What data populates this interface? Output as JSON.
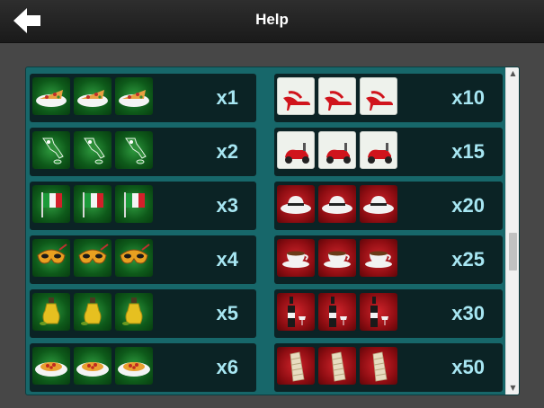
{
  "header": {
    "title": "Help"
  },
  "paytable": {
    "left": [
      {
        "symbol": "pizza-icon",
        "multiplier": "x1"
      },
      {
        "symbol": "italy-map-icon",
        "multiplier": "x2"
      },
      {
        "symbol": "italian-flag-icon",
        "multiplier": "x3"
      },
      {
        "symbol": "carnival-mask-icon",
        "multiplier": "x4"
      },
      {
        "symbol": "olive-oil-icon",
        "multiplier": "x5"
      },
      {
        "symbol": "spaghetti-icon",
        "multiplier": "x6"
      }
    ],
    "right": [
      {
        "symbol": "red-heels-icon",
        "multiplier": "x10"
      },
      {
        "symbol": "scooter-icon",
        "multiplier": "x15"
      },
      {
        "symbol": "hat-icon",
        "multiplier": "x20"
      },
      {
        "symbol": "coffee-cup-icon",
        "multiplier": "x25"
      },
      {
        "symbol": "wine-bottle-icon",
        "multiplier": "x30"
      },
      {
        "symbol": "leaning-tower-icon",
        "multiplier": "x50"
      }
    ]
  },
  "colors": {
    "green_tile": "#1f7a2e",
    "white_tile": "#eef2ec",
    "red_tile": "#b3141b",
    "multiplier_text": "#a7e6f2",
    "row_background": "#0b2325",
    "panel_background": "#17676a"
  }
}
